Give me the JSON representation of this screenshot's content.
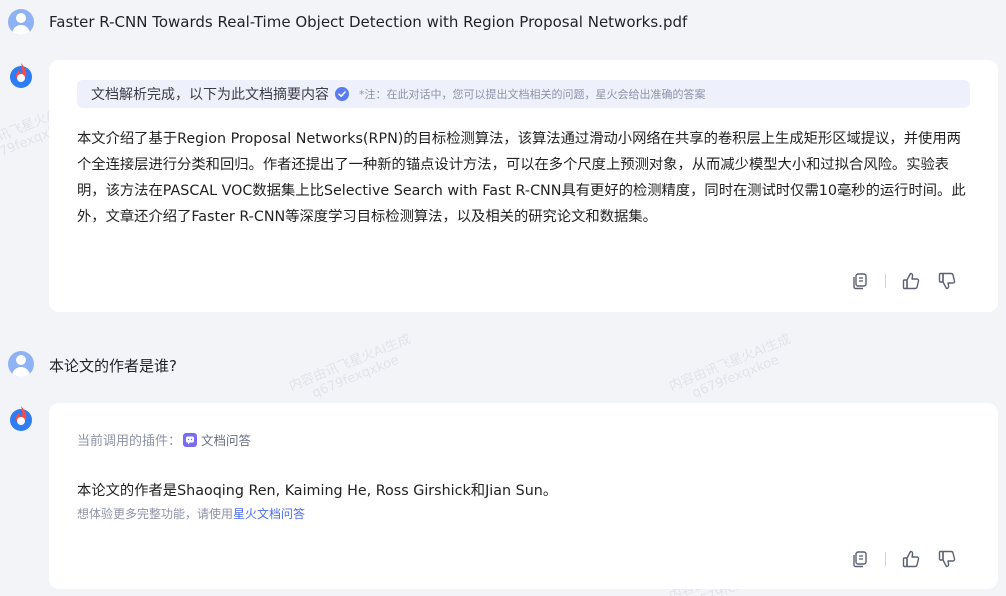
{
  "document": {
    "filename": "Faster R-CNN Towards Real-Time Object Detection with Region Proposal Networks.pdf"
  },
  "summary_card": {
    "notice_title": "文档解析完成，以下为此文档摘要内容",
    "notice_note": "*注：在此对话中，您可以提出文档相关的问题，星火会给出准确的答案",
    "summary_text": "本文介绍了基于Region Proposal Networks(RPN)的目标检测算法，该算法通过滑动小网络在共享的卷积层上生成矩形区域提议，并使用两个全连接层进行分类和回归。作者还提出了一种新的锚点设计方法，可以在多个尺度上预测对象，从而减少模型大小和过拟合风险。实验表明，该方法在PASCAL VOC数据集上比Selective Search with Fast R-CNN具有更好的检测精度，同时在测试时仅需10毫秒的运行时间。此外，文章还介绍了Faster R-CNN等深度学习目标检测算法，以及相关的研究论文和数据集。"
  },
  "question": {
    "text": "本论文的作者是谁?"
  },
  "answer_card": {
    "plugin_label": "当前调用的插件：",
    "plugin_name": "文档问答",
    "answer_text": "本论文的作者是Shaoqing Ren, Kaiming He, Ross Girshick和Jian Sun。",
    "hint_prefix": "想体验更多完整功能，请使用",
    "hint_link": "星火文档问答"
  },
  "watermark": {
    "line1": "内容由讯飞星火AI生成",
    "line2": "q679fexqxkoe"
  },
  "icons": {
    "copy": "copy-icon",
    "like": "thumbs-up-icon",
    "dislike": "thumbs-down-icon",
    "verified": "check-circle-icon",
    "plugin": "chat-bubble-icon",
    "bot": "spark-logo-icon",
    "user": "user-avatar-icon"
  },
  "colors": {
    "accent": "#5a7cf0",
    "link": "#4f6df5",
    "background": "#f3f4f8"
  }
}
